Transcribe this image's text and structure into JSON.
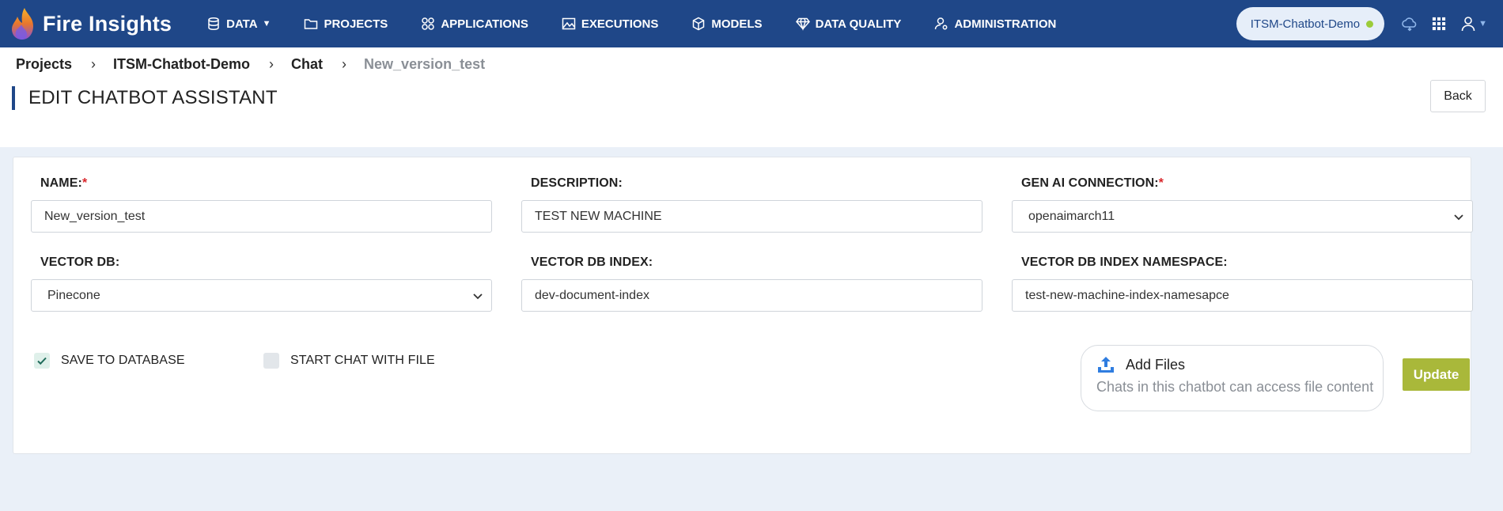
{
  "app": {
    "brand_name": "Fire Insights",
    "colors": {
      "navbar": "#1f4788",
      "accent": "#a9b83a",
      "required": "#d9262b",
      "status_online": "#9ccc3a"
    }
  },
  "nav": {
    "items": [
      {
        "label": "DATA",
        "icon": "database-icon",
        "has_dropdown": true
      },
      {
        "label": "PROJECTS",
        "icon": "folder-icon"
      },
      {
        "label": "APPLICATIONS",
        "icon": "applications-grid-icon"
      },
      {
        "label": "EXECUTIONS",
        "icon": "chart-image-icon"
      },
      {
        "label": "MODELS",
        "icon": "cube-icon"
      },
      {
        "label": "DATA QUALITY",
        "icon": "diamond-icon"
      },
      {
        "label": "ADMINISTRATION",
        "icon": "user-gear-icon"
      }
    ],
    "current_project": "ITSM-Chatbot-Demo",
    "right_icons": [
      "cloud-icon",
      "apps-grid-icon",
      "user-icon"
    ]
  },
  "breadcrumb": {
    "items": [
      "Projects",
      "ITSM-Chatbot-Demo",
      "Chat",
      "New_version_test"
    ]
  },
  "page": {
    "title": "EDIT CHATBOT ASSISTANT",
    "back_label": "Back"
  },
  "form": {
    "name": {
      "label": "NAME:",
      "required": "*",
      "value": "New_version_test"
    },
    "description": {
      "label": "DESCRIPTION:",
      "value": "TEST NEW MACHINE"
    },
    "gen_ai_connection": {
      "label": "GEN AI CONNECTION:",
      "required": "*",
      "value": "openaimarch11"
    },
    "vector_db": {
      "label": "VECTOR DB:",
      "value": "Pinecone"
    },
    "vector_db_index": {
      "label": "VECTOR DB INDEX:",
      "value": "dev-document-index"
    },
    "vector_db_index_namespace": {
      "label": "VECTOR DB INDEX NAMESPACE:",
      "value": "test-new-machine-index-namesapce"
    },
    "save_to_database": {
      "label": "SAVE TO DATABASE",
      "checked": true
    },
    "start_chat_with_file": {
      "label": "START CHAT WITH FILE",
      "checked": false
    },
    "add_files": {
      "title": "Add Files",
      "subtitle": "Chats in this chatbot can access file content"
    },
    "update_label": "Update"
  }
}
